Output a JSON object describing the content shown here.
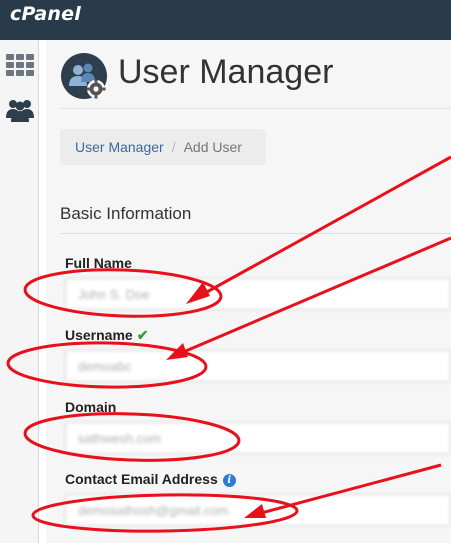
{
  "app": {
    "logo": "cPanel"
  },
  "sidebar": {
    "items": [
      {
        "icon": "grid-icon"
      },
      {
        "icon": "users-icon"
      }
    ]
  },
  "page": {
    "title": "User Manager",
    "title_icon": "user-manager-gear-icon"
  },
  "breadcrumb": {
    "parent": "User Manager",
    "separator": "/",
    "current": "Add User"
  },
  "section": {
    "title": "Basic Information"
  },
  "form": {
    "full_name": {
      "label": "Full Name",
      "value": "John S. Doe"
    },
    "username": {
      "label": "Username",
      "valid_mark": "✔",
      "value": "demoabc"
    },
    "domain": {
      "label": "Domain",
      "value": "sathwesh.com"
    },
    "email": {
      "label": "Contact Email Address",
      "info": "i",
      "value": "demosathosh@gmail.com"
    }
  },
  "colors": {
    "topbar": "#293a4a",
    "annotation": "#e8101a",
    "link": "#3b6a9e",
    "valid": "#3c9a3c",
    "info": "#2d7bd4"
  }
}
